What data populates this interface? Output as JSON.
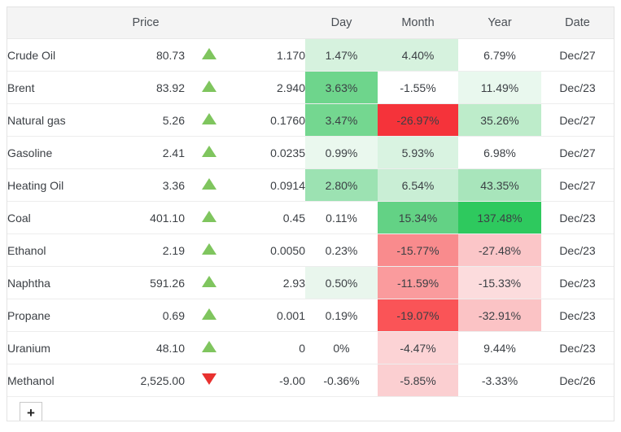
{
  "table": {
    "columns": [
      {
        "key": "name",
        "label": "",
        "align": "left"
      },
      {
        "key": "price",
        "label": "Price",
        "align": "center"
      },
      {
        "key": "arrow",
        "label": "",
        "align": "center"
      },
      {
        "key": "chg",
        "label": "",
        "align": "right"
      },
      {
        "key": "day",
        "label": "Day",
        "align": "center"
      },
      {
        "key": "month",
        "label": "Month",
        "align": "center"
      },
      {
        "key": "year",
        "label": "Year",
        "align": "center"
      },
      {
        "key": "date",
        "label": "Date",
        "align": "center"
      }
    ],
    "rows": [
      {
        "name": "Crude Oil",
        "price": "80.73",
        "dir": "up",
        "chg": "1.170",
        "day": "1.47%",
        "day_bg": "#d6f2de",
        "month": "4.40%",
        "month_bg": "#d6f2de",
        "year": "6.79%",
        "year_bg": "#ffffff",
        "date": "Dec/27"
      },
      {
        "name": "Brent",
        "price": "83.92",
        "dir": "up",
        "chg": "2.940",
        "day": "3.63%",
        "day_bg": "#6ed58c",
        "month": "-1.55%",
        "month_bg": "#ffffff",
        "year": "11.49%",
        "year_bg": "#e9f8ee",
        "date": "Dec/23"
      },
      {
        "name": "Natural gas",
        "price": "5.26",
        "dir": "up",
        "chg": "0.1760",
        "day": "3.47%",
        "day_bg": "#74d790",
        "month": "-26.97%",
        "month_bg": "#f5333a",
        "year": "35.26%",
        "year_bg": "#bdecca",
        "date": "Dec/27"
      },
      {
        "name": "Gasoline",
        "price": "2.41",
        "dir": "up",
        "chg": "0.0235",
        "day": "0.99%",
        "day_bg": "#eaf8ee",
        "month": "5.93%",
        "month_bg": "#d9f3e1",
        "year": "6.98%",
        "year_bg": "#ffffff",
        "date": "Dec/27"
      },
      {
        "name": "Heating Oil",
        "price": "3.36",
        "dir": "up",
        "chg": "0.0914",
        "day": "2.80%",
        "day_bg": "#9ce2b2",
        "month": "6.54%",
        "month_bg": "#c9eed5",
        "year": "43.35%",
        "year_bg": "#a8e5bb",
        "date": "Dec/27"
      },
      {
        "name": "Coal",
        "price": "401.10",
        "dir": "up",
        "chg": "0.45",
        "day": "0.11%",
        "day_bg": "#ffffff",
        "month": "15.34%",
        "month_bg": "#63d285",
        "year": "137.48%",
        "year_bg": "#2ec95e",
        "date": "Dec/23"
      },
      {
        "name": "Ethanol",
        "price": "2.19",
        "dir": "up",
        "chg": "0.0050",
        "day": "0.23%",
        "day_bg": "#ffffff",
        "month": "-15.77%",
        "month_bg": "#f98b8d",
        "year": "-27.48%",
        "year_bg": "#fbc6c8",
        "date": "Dec/23"
      },
      {
        "name": "Naphtha",
        "price": "591.26",
        "dir": "up",
        "chg": "2.93",
        "day": "0.50%",
        "day_bg": "#e9f6ed",
        "month": "-11.59%",
        "month_bg": "#fa9b9d",
        "year": "-15.33%",
        "year_bg": "#fcdcdd",
        "date": "Dec/23"
      },
      {
        "name": "Propane",
        "price": "0.69",
        "dir": "up",
        "chg": "0.001",
        "day": "0.19%",
        "day_bg": "#ffffff",
        "month": "-19.07%",
        "month_bg": "#fa5457",
        "year": "-32.91%",
        "year_bg": "#fbc3c5",
        "date": "Dec/23"
      },
      {
        "name": "Uranium",
        "price": "48.10",
        "dir": "up",
        "chg": "0",
        "day": "0%",
        "day_bg": "#ffffff",
        "month": "-4.47%",
        "month_bg": "#fcd3d5",
        "year": "9.44%",
        "year_bg": "#ffffff",
        "date": "Dec/23"
      },
      {
        "name": "Methanol",
        "price": "2,525.00",
        "dir": "down",
        "chg": "-9.00",
        "day": "-0.36%",
        "day_bg": "#ffffff",
        "month": "-5.85%",
        "month_bg": "#fbcfd1",
        "year": "-3.33%",
        "year_bg": "#ffffff",
        "date": "Dec/26"
      }
    ]
  },
  "footer": {
    "add_label": "+"
  },
  "colors": {
    "arrow_up": "#7fc55e",
    "arrow_down": "#e8312f",
    "header_bg": "#f4f4f4",
    "border": "#e3e3e3",
    "text": "#3b3f44"
  }
}
